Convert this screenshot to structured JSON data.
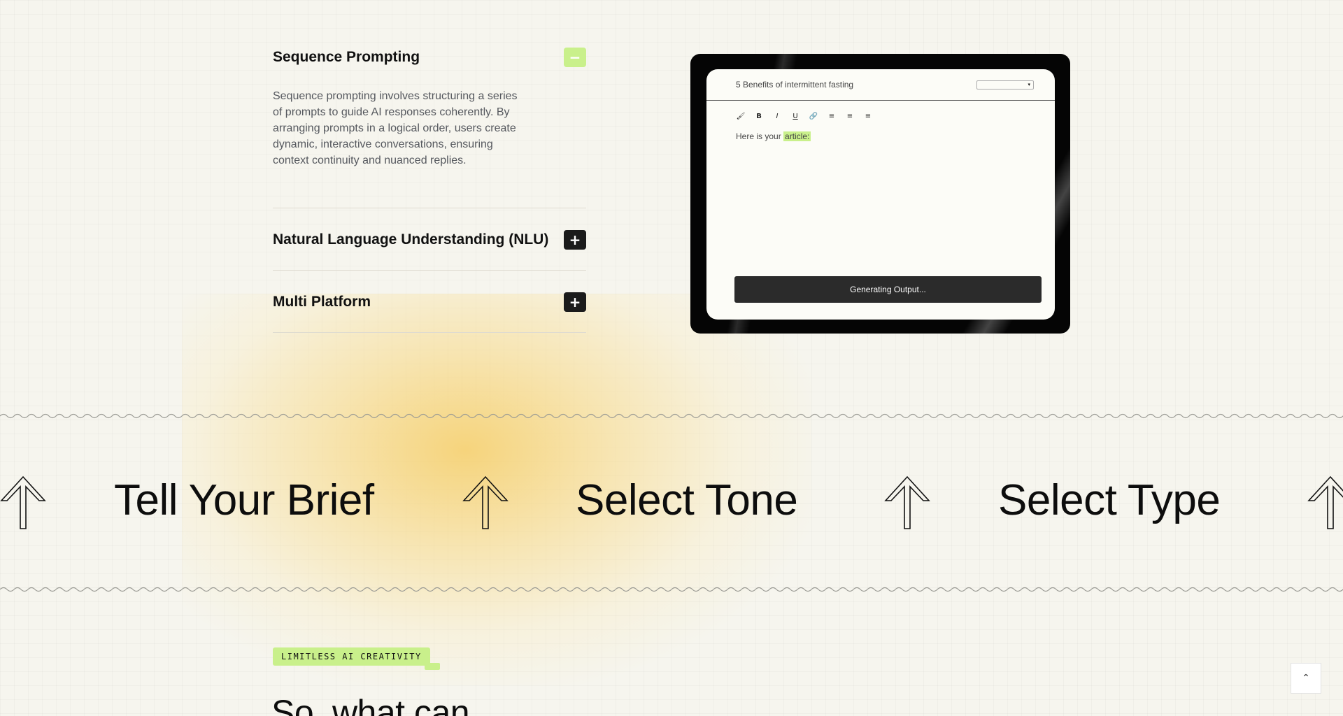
{
  "accordion": {
    "items": [
      {
        "title": "Sequence Prompting",
        "toggle": "−",
        "body": "Sequence prompting involves structuring a series of prompts to guide AI responses coherently. By arranging prompts in a logical order, users create dynamic, interactive conversations, ensuring context continuity and nuanced replies."
      },
      {
        "title": "Natural Language Understanding (NLU)",
        "toggle": "+"
      },
      {
        "title": "Multi Platform",
        "toggle": "+"
      }
    ]
  },
  "editor": {
    "doc_title": "5 Benefits of intermittent fasting",
    "select_caret": "▾",
    "toolbar": [
      "🖌",
      "B",
      "I",
      "U",
      "🔗",
      "≡",
      "≡",
      "≡"
    ],
    "text_prefix": "Here is your ",
    "text_highlight": "article:",
    "button": "Generating Output..."
  },
  "band": {
    "items": [
      "Tell Your Brief",
      "Select Tone",
      "Select Type"
    ]
  },
  "section": {
    "tag": "LIMITLESS AI CREATIVITY",
    "heading": "So, what can"
  },
  "scroll_top": {
    "icon": "chevron-up-icon",
    "glyph": "⌃"
  },
  "colors": {
    "accent": "#c9f08b",
    "dark": "#1b1b1b",
    "glow": "#f6ce68"
  }
}
